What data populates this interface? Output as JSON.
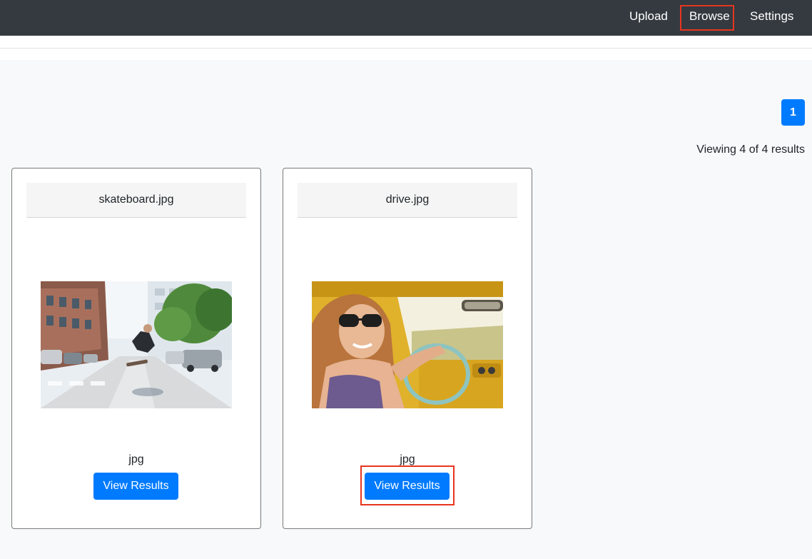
{
  "nav": {
    "upload": "Upload",
    "browse": "Browse",
    "settings": "Settings"
  },
  "pagination": {
    "current_page": "1"
  },
  "results_summary": "Viewing 4 of 4 results",
  "cards": [
    {
      "filename": "skateboard.jpg",
      "file_type": "jpg",
      "button_label": "View Results",
      "image_icon": "skateboarder-street-photo"
    },
    {
      "filename": "drive.jpg",
      "file_type": "jpg",
      "button_label": "View Results",
      "image_icon": "woman-driving-car-photo"
    }
  ],
  "colors": {
    "navbar": "#343a40",
    "accent": "#007bff",
    "highlight": "#e8351f"
  }
}
